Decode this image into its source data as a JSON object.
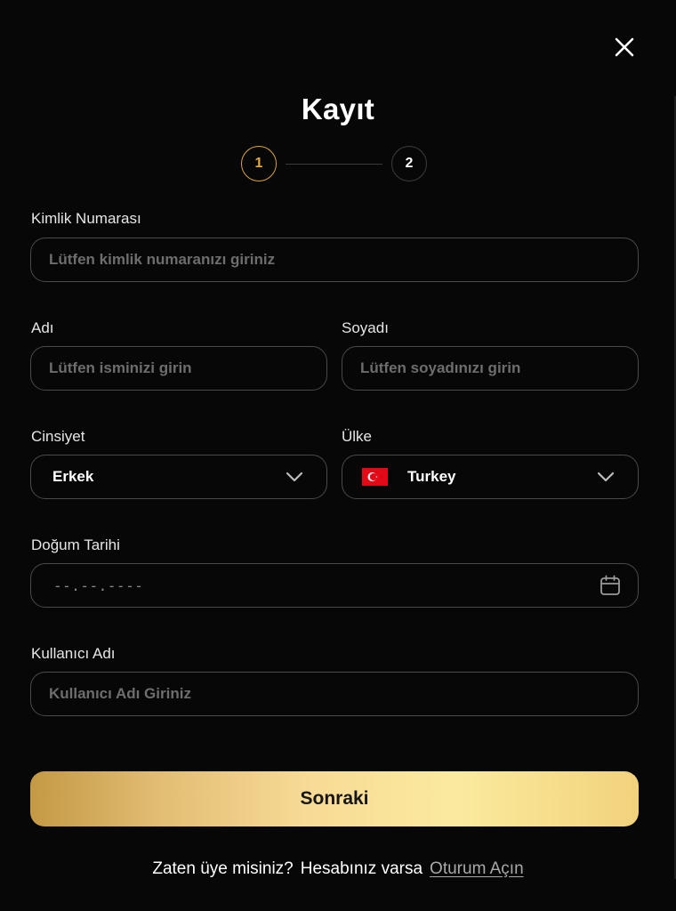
{
  "title": "Kayıt",
  "steps": [
    "1",
    "2"
  ],
  "fields": {
    "tc": {
      "label": "Kimlik Numarası",
      "placeholder": "Lütfen kimlik numaranızı giriniz",
      "value": ""
    },
    "first_name": {
      "label": "Adı",
      "placeholder": "Lütfen isminizi girin",
      "value": ""
    },
    "last_name": {
      "label": "Soyadı",
      "placeholder": "Lütfen soyadınızı girin",
      "value": ""
    },
    "gender": {
      "label": "Cinsiyet",
      "value": "Erkek"
    },
    "country": {
      "label": "Ülke",
      "value": "Turkey"
    },
    "birth_date": {
      "label": "Doğum Tarihi",
      "value": "--.--.----"
    },
    "username": {
      "label": "Kullanıcı Adı",
      "placeholder": "Kullanıcı Adı Giriniz",
      "value": ""
    }
  },
  "next_button": "Sonraki",
  "footer": {
    "question": "Zaten üye misiniz?",
    "text": "Hesabınız varsa",
    "link": "Oturum Açın"
  },
  "colors": {
    "background": "#070707",
    "accent": "#d9a441",
    "field_border": "#4a4a4a",
    "button_gradient": [
      "#c49944",
      "#f7da95",
      "#fbea9e",
      "#f2d27c"
    ]
  },
  "icons": [
    "close-icon",
    "chevron-down-icon",
    "turkey-flag-icon",
    "calendar-icon"
  ]
}
